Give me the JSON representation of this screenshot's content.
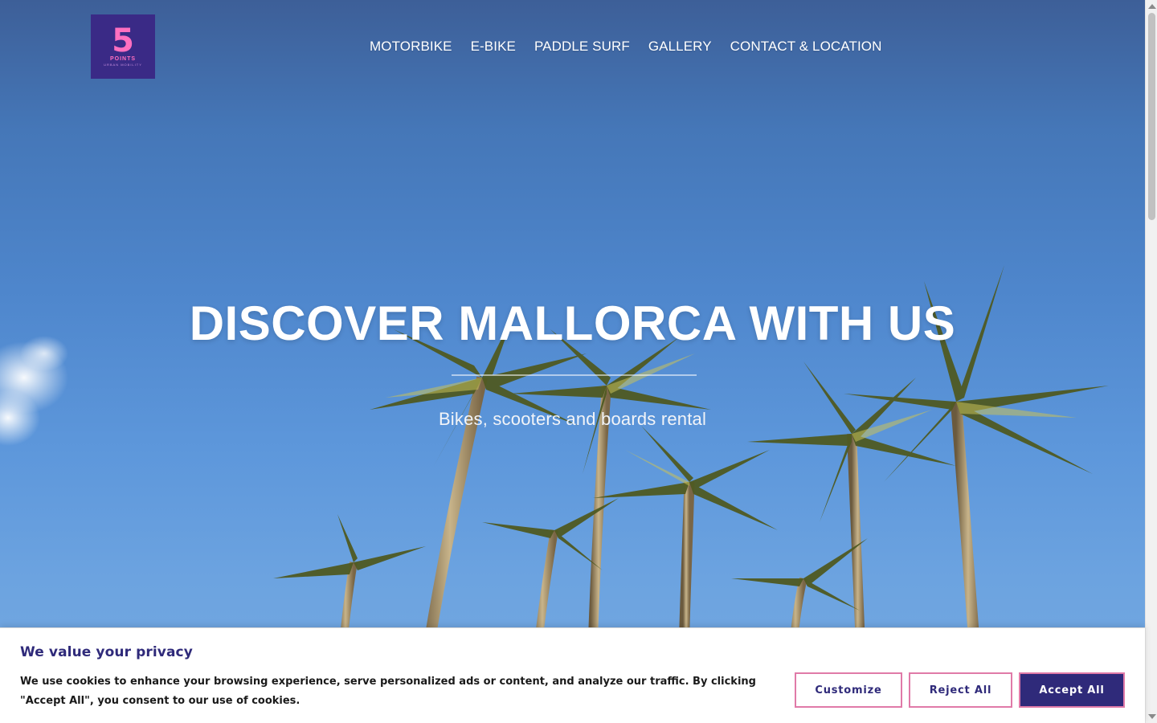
{
  "brand": {
    "logo_number": "5",
    "logo_word": "POINTS",
    "logo_tagline": "URBAN MOBILITY",
    "logo_bg": "#3a2a86",
    "logo_fg": "#ff6fc0"
  },
  "nav": {
    "items": [
      {
        "label": "MOTORBIKE"
      },
      {
        "label": "E-BIKE"
      },
      {
        "label": "PADDLE SURF"
      },
      {
        "label": "GALLERY"
      },
      {
        "label": "CONTACT & LOCATION"
      }
    ]
  },
  "hero": {
    "title": "DISCOVER MALLORCA WITH US",
    "subtitle": "Bikes, scooters and boards rental"
  },
  "cookie_banner": {
    "title": "We value your privacy",
    "text": "We use cookies to enhance your browsing experience, serve personalized ads or content, and analyze our traffic. By clicking \"Accept All\", you consent to our use of cookies.",
    "customize_label": "Customize",
    "reject_label": "Reject All",
    "accept_label": "Accept All",
    "accent_color": "#2f2a7a",
    "border_color": "#e07aa8"
  },
  "icons": {
    "scroll_up": "scroll-up-arrow-icon",
    "scroll_down": "scroll-down-arrow-icon"
  }
}
